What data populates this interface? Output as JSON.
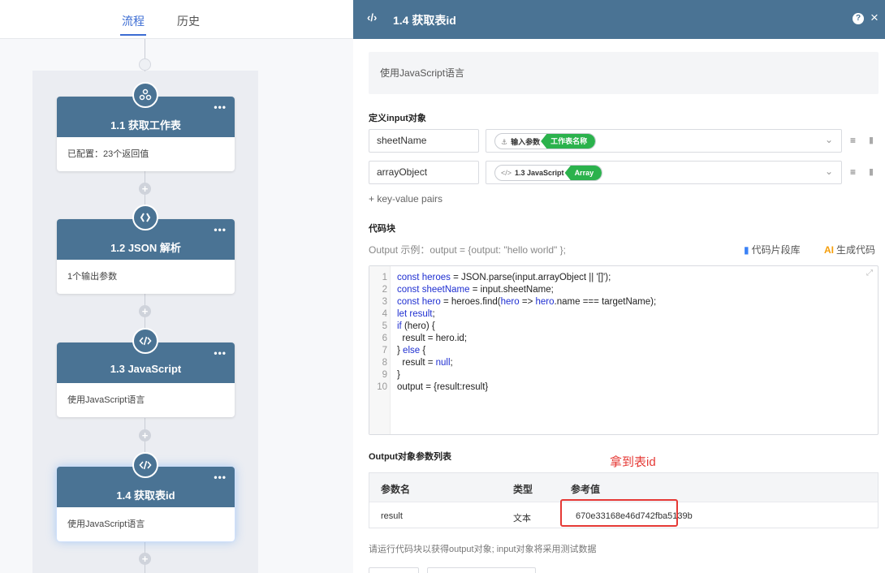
{
  "left": {
    "tabs": [
      {
        "label": "流程",
        "active": true
      },
      {
        "label": "历史",
        "active": false
      }
    ],
    "nodes": [
      {
        "title": "1.1 获取工作表",
        "body": "已配置：23个返回值",
        "icon": "webhook-icon"
      },
      {
        "title": "1.2 JSON 解析",
        "body": "1个输出参数",
        "icon": "json-icon"
      },
      {
        "title": "1.3 JavaScript",
        "body": "使用JavaScript语言",
        "icon": "code-icon"
      },
      {
        "title": "1.4 获取表id",
        "body": "使用JavaScript语言",
        "icon": "code-icon",
        "selected": true
      }
    ],
    "plus_label": "+",
    "more_label": "•••"
  },
  "right": {
    "header": {
      "code_icon": "‹/›",
      "title": "1.4 获取表id",
      "help": "?",
      "close": "×"
    },
    "description": "使用JavaScript语言",
    "input_section": "定义input对象",
    "inputs": [
      {
        "name": "sheetName",
        "source_icon": "webhook-icon",
        "source": "输入参数",
        "value": "工作表名称"
      },
      {
        "name": "arrayObject",
        "source_icon": "code-icon",
        "source": "1.3 JavaScript",
        "value": "Array"
      }
    ],
    "add_pairs": "+ key-value pairs",
    "code_section": "代码块",
    "output_example": "Output 示例：output = {output: \"hello world\" };",
    "snippet_lib": "代码片段库",
    "ai_label": "AI",
    "ai_gen": "生成代码",
    "code_lines": [
      "const heroes = JSON.parse(input.arrayObject || '[]');",
      "const sheetName = input.sheetName;",
      "const hero = heroes.find(hero => hero.name === targetName);",
      "let result;",
      "if (hero) {",
      "  result = hero.id;",
      "} else {",
      "  result = null;",
      "}",
      "output = {result:result}"
    ],
    "output_section": "Output对象参数列表",
    "annotation": "拿到表id",
    "table": {
      "headers": [
        "参数名",
        "类型",
        "参考值"
      ],
      "row": {
        "name": "result",
        "type": "文本",
        "value": "670e33168e46d742fba5139b"
      }
    },
    "run_hint": "请运行代码块以获得output对象; input对象将采用测试数据"
  },
  "colors": {
    "node_header": "#4a7394",
    "accent": "#3b6cd3",
    "chip_green": "#2bb24c",
    "annotation_red": "#e53935"
  }
}
